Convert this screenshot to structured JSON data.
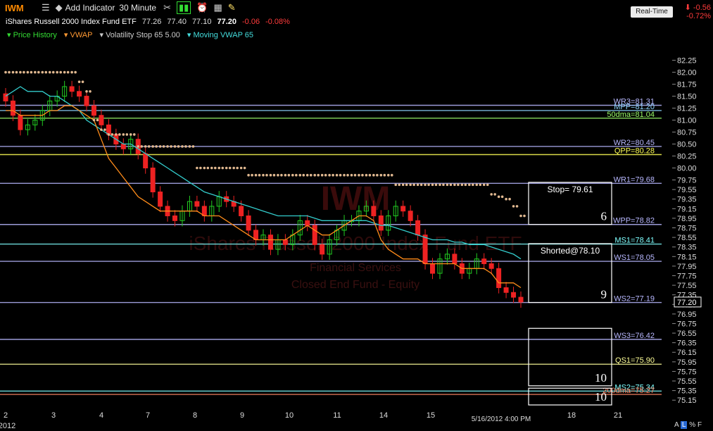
{
  "toolbar": {
    "symbol": "IWM",
    "add_indicator": "Add Indicator",
    "interval": "30 Minute",
    "realtime": "Real-Time"
  },
  "quote": {
    "name": "iShares Russell 2000 Index Fund ETF",
    "open": "77.26",
    "high": "77.40",
    "low": "77.10",
    "last": "77.20",
    "change": "-0.06",
    "pct": "-0.08%",
    "net_change": "-0.56",
    "net_pct": "-0.72%"
  },
  "studies": {
    "price_history": "Price History",
    "vwap": "VWAP",
    "vol_stop": "Volatility Stop 65 5.00",
    "moving_vwap": "Moving VWAP 65"
  },
  "watermark": {
    "symbol": "IWM",
    "name": "iShares Russell 2000 Index Fund ETF",
    "sector": "Financial Services",
    "type": "Closed End Fund - Equity"
  },
  "chart_data": {
    "type": "candlestick",
    "y_axis_ticks": [
      "82.25",
      "82.00",
      "81.75",
      "81.50",
      "81.25",
      "81.00",
      "80.75",
      "80.50",
      "80.25",
      "80.00",
      "79.75",
      "79.55",
      "79.35",
      "79.15",
      "78.95",
      "78.75",
      "78.55",
      "78.35",
      "78.15",
      "77.95",
      "77.75",
      "77.55",
      "77.35",
      "77.15",
      "76.95",
      "76.75",
      "76.55",
      "76.35",
      "76.15",
      "75.95",
      "75.75",
      "75.55",
      "75.35",
      "75.15"
    ],
    "ylim": [
      75.05,
      82.45
    ],
    "x_axis_ticks": [
      "2",
      "3",
      "4",
      "7",
      "8",
      "9",
      "10",
      "11",
      "14",
      "15",
      "18",
      "21"
    ],
    "x_year": "2012",
    "cursor_date": "5/16/2012 4:00 PM",
    "last_price": "77.20",
    "levels": [
      {
        "label": "WR3=81.31",
        "value": 81.31,
        "color": "#b8b8ff"
      },
      {
        "label": "MPP=81.20",
        "value": 81.2,
        "color": "#8fd6ff"
      },
      {
        "label": "50dma=81.04",
        "value": 81.04,
        "color": "#9cff6a"
      },
      {
        "label": "WR2=80.45",
        "value": 80.45,
        "color": "#b8b8ff"
      },
      {
        "label": "QPP=80.28",
        "value": 80.28,
        "color": "#ffff55"
      },
      {
        "label": "WR1=79.68",
        "value": 79.68,
        "color": "#b8b8ff"
      },
      {
        "label": "WPP=78.82",
        "value": 78.82,
        "color": "#b8b8ff"
      },
      {
        "label": "MS1=78.41",
        "value": 78.41,
        "color": "#7fffff"
      },
      {
        "label": "WS1=78.05",
        "value": 78.05,
        "color": "#b8b8ff"
      },
      {
        "label": "WS2=77.19",
        "value": 77.19,
        "color": "#b8b8ff"
      },
      {
        "label": "WS3=76.42",
        "value": 76.42,
        "color": "#b8b8ff"
      },
      {
        "label": "QS1=75.90",
        "value": 75.9,
        "color": "#ffff99"
      },
      {
        "label": "MS2=75.34",
        "value": 75.34,
        "color": "#7fffff"
      },
      {
        "label": "200dma=75.27",
        "value": 75.27,
        "color": "#ff8866"
      }
    ],
    "annotations": [
      {
        "text": "Stop= 79.61",
        "number": "6"
      },
      {
        "text": "Shorted@78.10",
        "number": "9"
      },
      {
        "text": "",
        "number": "10"
      },
      {
        "text": "",
        "number": "10"
      }
    ],
    "closes": [
      81.4,
      81.1,
      80.8,
      80.9,
      81.0,
      81.2,
      81.4,
      81.5,
      81.7,
      81.6,
      81.5,
      81.3,
      81.1,
      80.9,
      80.7,
      80.5,
      80.4,
      80.6,
      80.3,
      80.0,
      79.5,
      79.2,
      79.0,
      78.9,
      79.1,
      79.3,
      79.2,
      79.0,
      79.2,
      79.4,
      79.3,
      79.2,
      79.0,
      78.7,
      78.5,
      78.6,
      78.3,
      78.5,
      78.4,
      78.6,
      78.9,
      78.8,
      78.4,
      78.2,
      78.5,
      78.7,
      78.9,
      78.9,
      79.1,
      79.2,
      79.0,
      78.7,
      79.0,
      79.2,
      79.1,
      78.9,
      78.6,
      78.0,
      77.8,
      78.1,
      78.2,
      78.0,
      77.8,
      77.9,
      78.1,
      78.0,
      77.9,
      77.5,
      77.4,
      77.3,
      77.2
    ],
    "vwap": [
      81.2,
      81.2,
      81.1,
      81.1,
      81.1,
      81.1,
      81.2,
      81.2,
      81.3,
      81.3,
      81.2,
      81.1,
      81.0,
      80.6,
      80.2,
      80.0,
      79.8,
      79.6,
      79.4,
      79.3,
      79.2,
      79.1,
      79.1,
      79.1,
      79.1,
      79.1,
      79.1,
      79.0,
      79.0,
      79.0,
      78.9,
      78.8,
      78.7,
      78.6,
      78.5,
      78.5,
      78.5,
      78.5,
      78.5,
      78.6,
      78.7,
      78.8,
      78.7,
      78.6,
      78.6,
      78.7,
      78.8,
      78.9,
      79.0,
      79.0,
      78.9,
      78.5,
      78.3,
      78.2,
      78.1,
      78.1,
      78.1,
      78.0,
      78.0,
      78.0,
      78.0,
      78.0,
      77.9,
      77.9,
      77.9,
      77.9,
      77.8,
      77.6,
      77.6,
      77.6,
      77.5
    ],
    "moving_vwap": [
      81.5,
      81.6,
      81.7,
      81.6,
      81.6,
      81.6,
      81.5,
      81.5,
      81.4,
      81.3,
      81.2,
      81.0,
      80.9,
      80.8,
      80.7,
      80.6,
      80.5,
      80.5,
      80.4,
      80.3,
      80.2,
      80.1,
      80.0,
      79.9,
      79.8,
      79.7,
      79.6,
      79.5,
      79.45,
      79.4,
      79.35,
      79.3,
      79.25,
      79.2,
      79.15,
      79.1,
      79.05,
      79.0,
      79.0,
      79.0,
      79.0,
      79.0,
      78.95,
      78.9,
      78.9,
      78.9,
      78.9,
      78.9,
      78.9,
      78.9,
      78.85,
      78.8,
      78.8,
      78.75,
      78.7,
      78.65,
      78.6,
      78.55,
      78.5,
      78.5,
      78.5,
      78.45,
      78.45,
      78.4,
      78.4,
      78.4,
      78.35,
      78.3,
      78.25,
      78.2,
      78.1
    ],
    "vol_stop": [
      82.0,
      82.0,
      82.0,
      82.0,
      82.0,
      82.0,
      82.0,
      82.0,
      82.0,
      82.0,
      81.8,
      81.6,
      81.0,
      80.8,
      80.7,
      80.7,
      80.7,
      80.7,
      80.45,
      80.45,
      80.45,
      80.45,
      80.45,
      80.45,
      80.45,
      80.45,
      80.0,
      80.0,
      80.0,
      80.0,
      80.0,
      80.0,
      80.0,
      79.85,
      79.85,
      79.85,
      79.85,
      79.85,
      79.85,
      79.85,
      79.85,
      79.85,
      79.85,
      79.85,
      79.85,
      79.85,
      79.85,
      79.85,
      79.85,
      79.85,
      79.85,
      79.85,
      79.85,
      79.65,
      79.65,
      79.65,
      79.65,
      79.65,
      79.65,
      79.65,
      79.65,
      79.65,
      79.65,
      79.65,
      79.65,
      79.65,
      79.45,
      79.4,
      79.35,
      79.2,
      79.0
    ]
  },
  "status": {
    "a": "A",
    "l": "L",
    "pct": "%",
    "f": "F"
  }
}
